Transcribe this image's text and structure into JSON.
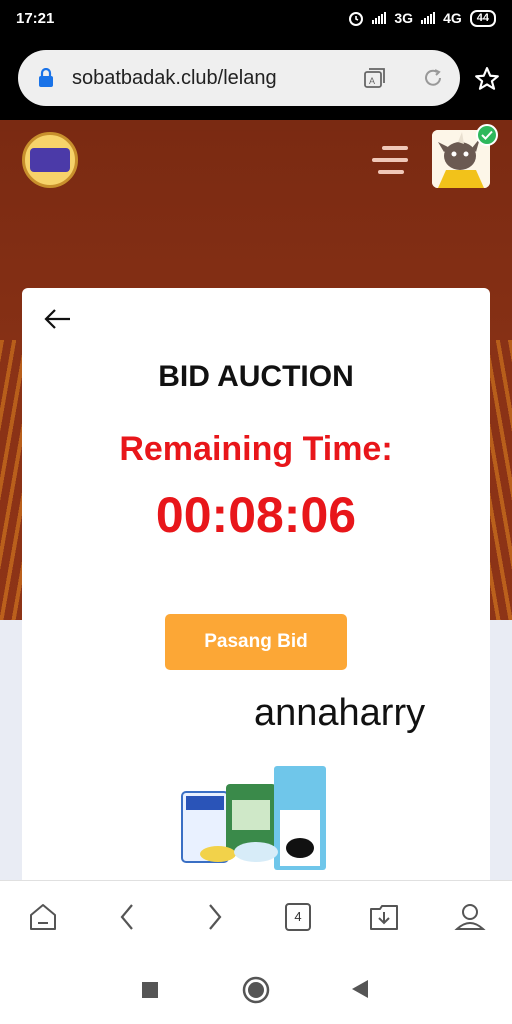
{
  "status_bar": {
    "time": "17:21",
    "network1": "3G",
    "network2": "4G",
    "battery": "44"
  },
  "browser": {
    "url": "sobatbadak.club/lelang",
    "tab_count": "4",
    "icons": [
      "lock-icon",
      "translate-icon",
      "reload-icon",
      "star-icon",
      "home-icon",
      "back-icon",
      "forward-icon",
      "tabs-icon",
      "download-icon",
      "profile-icon"
    ]
  },
  "header": {
    "icons": [
      "club-logo-icon",
      "hamburger-menu-icon",
      "avatar-icon",
      "verified-check-icon"
    ]
  },
  "card": {
    "title": "BID AUCTION",
    "remaining_label": "Remaining Time:",
    "timer": "00:08:06",
    "bid_button": "Pasang Bid",
    "username": "annaharry"
  },
  "colors": {
    "accent_red": "#e8161a",
    "button_orange": "#fca736",
    "hero_brown": "#8a3216"
  }
}
